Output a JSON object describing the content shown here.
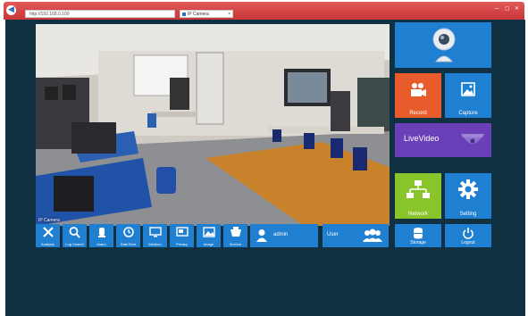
{
  "browser": {
    "address_text": "http://192.168.0.100",
    "tab_title": "IP Camera",
    "window_controls": "— ◻ ✕"
  },
  "video": {
    "label": "IP Camera"
  },
  "toolbar": {
    "analysis": "Analysis",
    "log_search": "Log Search",
    "alarm": "Alarm",
    "date_time": "DateTime",
    "sharp_mode": "Medium",
    "privacy": "Privacy",
    "image": "Image",
    "service": "Service",
    "user_name": "admin",
    "user_label": "User"
  },
  "tiles": {
    "record": "Record",
    "capture": "Capture",
    "live_video": "LiveVideo",
    "network": "Network",
    "setting": "Setting",
    "storage": "Storage",
    "logout": "Logout"
  },
  "colors": {
    "app_bg": "#0f3142",
    "tile_blue": "#1f7fd1",
    "tile_orange": "#e85c2c",
    "tile_purple": "#6a3fb8",
    "tile_green": "#8ac42b",
    "chrome_red": "#d24242"
  },
  "icons": [
    "back-icon",
    "webcam-icon",
    "video-camera-icon",
    "picture-icon",
    "dome-camera-icon",
    "network-icon",
    "gear-icon",
    "database-icon",
    "power-icon",
    "wrench-icon",
    "search-icon",
    "alarm-icon",
    "clock-icon",
    "monitor-icon",
    "screen-icon",
    "image-icon",
    "service-icon",
    "user-icon",
    "users-icon"
  ]
}
